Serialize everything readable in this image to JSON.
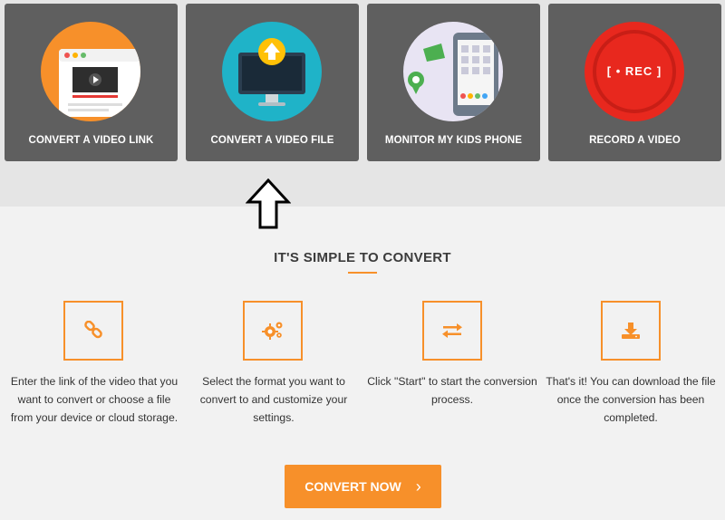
{
  "cards": [
    {
      "label": "CONVERT A VIDEO LINK",
      "icon": "browser-video-icon"
    },
    {
      "label": "CONVERT A VIDEO FILE",
      "icon": "monitor-upload-icon"
    },
    {
      "label": "MONITOR MY KIDS PHONE",
      "icon": "phone-location-icon"
    },
    {
      "label": "RECORD A VIDEO",
      "icon": "record-icon",
      "rec_text": "[ • REC ]"
    }
  ],
  "section": {
    "title": "IT'S SIMPLE TO CONVERT"
  },
  "steps": [
    {
      "icon": "link-icon",
      "text": "Enter the link of the video that you want to convert or choose a file from your device or cloud storage."
    },
    {
      "icon": "gears-icon",
      "text": "Select the format you want to convert to and customize your settings."
    },
    {
      "icon": "swap-arrows-icon",
      "text": "Click \"Start\" to start the conversion process."
    },
    {
      "icon": "download-icon",
      "text": "That's it! You can download the file once the conversion has been completed."
    }
  ],
  "cta": {
    "label": "CONVERT NOW",
    "chevron": "›"
  },
  "colors": {
    "accent": "#f7902a",
    "card_bg": "#5f5f5f",
    "teal": "#1fb3c8",
    "rec_red": "#e8281e"
  }
}
